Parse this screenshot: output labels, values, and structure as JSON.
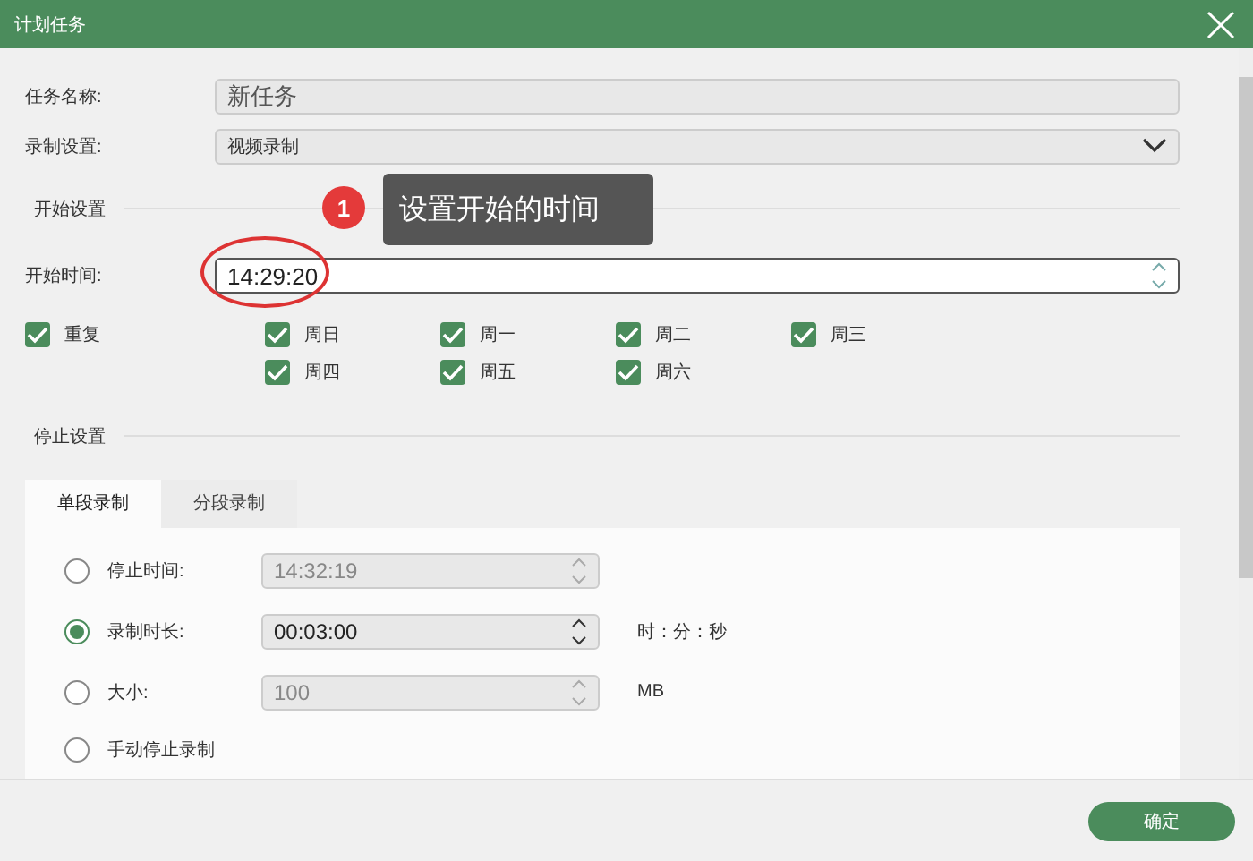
{
  "window": {
    "title": "计划任务"
  },
  "task_name": {
    "label": "任务名称:",
    "value": "新任务"
  },
  "record_setting": {
    "label": "录制设置:",
    "value": "视频录制"
  },
  "start_section": {
    "title": "开始设置"
  },
  "start_time": {
    "label": "开始时间:",
    "value": "14:29:20"
  },
  "repeat": {
    "label": "重复",
    "checked": true
  },
  "days": [
    {
      "label": "周日",
      "checked": true
    },
    {
      "label": "周一",
      "checked": true
    },
    {
      "label": "周二",
      "checked": true
    },
    {
      "label": "周三",
      "checked": true
    },
    {
      "label": "周四",
      "checked": true
    },
    {
      "label": "周五",
      "checked": true
    },
    {
      "label": "周六",
      "checked": true
    }
  ],
  "stop_section": {
    "title": "停止设置"
  },
  "tabs": [
    {
      "label": "单段录制",
      "selected": true
    },
    {
      "label": "分段录制",
      "selected": false
    }
  ],
  "stop_options": [
    {
      "label": "停止时间:",
      "selected": false,
      "value": "14:32:19",
      "disabled": true
    },
    {
      "label": "录制时长:",
      "selected": true,
      "value": "00:03:00",
      "disabled": false,
      "unit": "时：分：秒"
    },
    {
      "label": "大小:",
      "selected": false,
      "value": "100",
      "disabled": true,
      "unit": "MB"
    },
    {
      "label": "手动停止录制",
      "selected": false
    }
  ],
  "annotation": {
    "number": "1",
    "text": "设置开始的时间"
  },
  "buttons": [
    {
      "label": "确定"
    }
  ]
}
